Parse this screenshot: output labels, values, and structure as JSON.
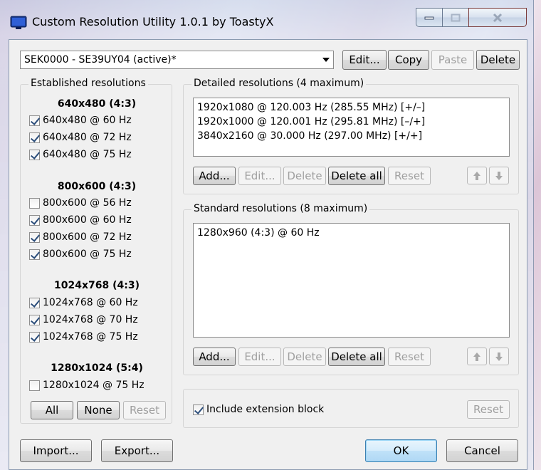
{
  "window": {
    "title": "Custom Resolution Utility 1.0.1 by ToastyX"
  },
  "toolbar": {
    "monitor_value": "SEK0000 - SE39UY04 (active)*",
    "edit_label": "Edit...",
    "copy_label": "Copy",
    "paste_label": "Paste",
    "delete_label": "Delete"
  },
  "established": {
    "title": "Established resolutions",
    "groups": [
      {
        "heading": "640x480 (4:3)",
        "items": [
          {
            "label": "640x480 @ 60 Hz",
            "checked": true
          },
          {
            "label": "640x480 @ 72 Hz",
            "checked": true
          },
          {
            "label": "640x480 @ 75 Hz",
            "checked": true
          }
        ]
      },
      {
        "heading": "800x600 (4:3)",
        "items": [
          {
            "label": "800x600 @ 56 Hz",
            "checked": false
          },
          {
            "label": "800x600 @ 60 Hz",
            "checked": true
          },
          {
            "label": "800x600 @ 72 Hz",
            "checked": true
          },
          {
            "label": "800x600 @ 75 Hz",
            "checked": true
          }
        ]
      },
      {
        "heading": "1024x768 (4:3)",
        "items": [
          {
            "label": "1024x768 @ 60 Hz",
            "checked": true
          },
          {
            "label": "1024x768 @ 70 Hz",
            "checked": true
          },
          {
            "label": "1024x768 @ 75 Hz",
            "checked": true
          }
        ]
      },
      {
        "heading": "1280x1024 (5:4)",
        "items": [
          {
            "label": "1280x1024 @ 75 Hz",
            "checked": false
          }
        ]
      }
    ],
    "all_label": "All",
    "none_label": "None",
    "reset_label": "Reset"
  },
  "detailed": {
    "title": "Detailed resolutions (4 maximum)",
    "items": [
      "1920x1080 @ 120.003 Hz (285.55 MHz) [+/–]",
      "1920x1000 @ 120.001 Hz (295.81 MHz) [–/+]",
      "3840x2160 @ 30.000 Hz (297.00 MHz) [+/+]"
    ],
    "add_label": "Add...",
    "edit_label": "Edit...",
    "delete_label": "Delete",
    "delete_all_label": "Delete all",
    "reset_label": "Reset"
  },
  "standard": {
    "title": "Standard resolutions (8 maximum)",
    "items": [
      "1280x960 (4:3) @ 60 Hz"
    ],
    "add_label": "Add...",
    "edit_label": "Edit...",
    "delete_label": "Delete",
    "delete_all_label": "Delete all",
    "reset_label": "Reset"
  },
  "extension": {
    "include_label": "Include extension block",
    "checked": true,
    "reset_label": "Reset"
  },
  "footer": {
    "import_label": "Import...",
    "export_label": "Export...",
    "ok_label": "OK",
    "cancel_label": "Cancel"
  },
  "icons": [
    "monitor-icon",
    "minimize-icon",
    "maximize-icon",
    "close-icon",
    "arrow-up-icon",
    "arrow-down-icon",
    "dropdown-arrow-icon",
    "checkbox-check-icon"
  ]
}
